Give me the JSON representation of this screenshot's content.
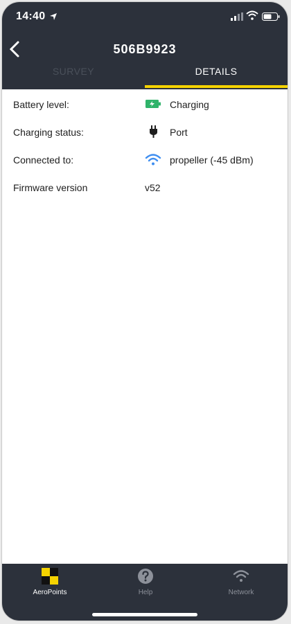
{
  "status_bar": {
    "time": "14:40",
    "icons": [
      "location-arrow-icon",
      "signal-icon",
      "wifi-icon",
      "battery-icon"
    ]
  },
  "header": {
    "title": "506B9923"
  },
  "tabs": [
    {
      "label": "SURVEY",
      "active": false
    },
    {
      "label": "DETAILS",
      "active": true
    }
  ],
  "details": [
    {
      "label": "Battery level:",
      "icon": "battery-charging-icon",
      "value": "Charging"
    },
    {
      "label": "Charging status:",
      "icon": "plug-icon",
      "value": "Port"
    },
    {
      "label": "Connected to:",
      "icon": "wifi-icon",
      "value": "propeller (-45 dBm)"
    },
    {
      "label": "Firmware version",
      "value": "v52"
    }
  ],
  "bottom_nav": [
    {
      "label": "AeroPoints",
      "icon": "aeropoints-checker-icon",
      "active": true
    },
    {
      "label": "Help",
      "icon": "help-icon",
      "active": false
    },
    {
      "label": "Network",
      "icon": "wifi-icon",
      "active": false
    }
  ],
  "colors": {
    "header_bg": "#2c313b",
    "accent": "#f5d300",
    "battery_green": "#2fb36a",
    "wifi_blue": "#3f8ef0"
  }
}
